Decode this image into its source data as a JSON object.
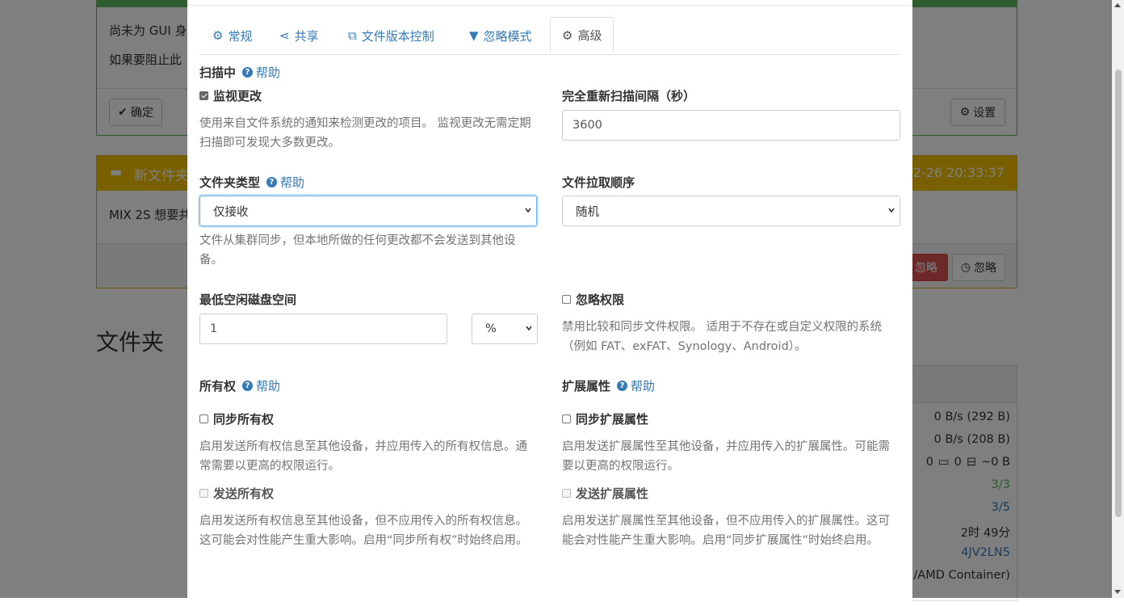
{
  "background": {
    "notice_text1": "尚未为 GUI 身",
    "notice_text2": "如果要阻止此",
    "ok_button": "确定",
    "settings_button": "设置",
    "folder_panel_title": "新文件夹",
    "folder_panel_time": "2-26 20:33:37",
    "folder_panel_text": "MIX 2S 想要共",
    "ignore_red_button": "忽略",
    "ignore_button": "忽略",
    "folders_heading": "文件夹",
    "stats": [
      "0 B/s (292 B)",
      "0 B/s (208 B)",
      "0",
      "0",
      "~0 B",
      "3/3",
      "3/5",
      "2时 49分",
      "4JV2LN5",
      "/AMD Container)"
    ]
  },
  "tabs": [
    {
      "label": "常规",
      "icon": "gear-icon"
    },
    {
      "label": "共享",
      "icon": "share-icon"
    },
    {
      "label": "文件版本控制",
      "icon": "copy-icon"
    },
    {
      "label": "忽略模式",
      "icon": "filter-icon"
    },
    {
      "label": "高级",
      "icon": "gears-icon",
      "active": true
    }
  ],
  "scanning": {
    "heading": "扫描中",
    "help": "帮助",
    "watch_label": "监视更改",
    "watch_checked": true,
    "watch_desc": "使用来自文件系统的通知来检测更改的项目。 监视更改无需定期扫描即可发现大多数更改。",
    "rescan_label": "完全重新扫描间隔（秒）",
    "rescan_value": "3600"
  },
  "folder_type": {
    "label": "文件夹类型",
    "help": "帮助",
    "value": "仅接收",
    "desc": "文件从集群同步，但本地所做的任何更改都不会发送到其他设备。"
  },
  "pull_order": {
    "label": "文件拉取顺序",
    "value": "随机"
  },
  "min_disk": {
    "label": "最低空闲磁盘空间",
    "value": "1",
    "unit": "%"
  },
  "ignore_perms": {
    "label": "忽略权限",
    "checked": false,
    "desc": "禁用比较和同步文件权限。 适用于不存在或自定义权限的系统（例如 FAT、exFAT、Synology、Android）。"
  },
  "ownership": {
    "heading": "所有权",
    "help": "帮助",
    "sync_label": "同步所有权",
    "sync_desc": "启用发送所有权信息至其他设备，并应用传入的所有权信息。通常需要以更高的权限运行。",
    "send_label": "发送所有权",
    "send_desc": "启用发送所有权信息至其他设备，但不应用传入的所有权信息。这可能会对性能产生重大影响。启用“同步所有权”时始终启用。"
  },
  "xattrs": {
    "heading": "扩展属性",
    "help": "帮助",
    "sync_label": "同步扩展属性",
    "sync_desc": "启用发送扩展属性至其他设备，并应用传入的扩展属性。可能需要以更高的权限运行。",
    "send_label": "发送扩展属性",
    "send_desc": "启用发送扩展属性至其他设备，但不应用传入的扩展属性。这可能会对性能产生重大影响。启用“同步扩展属性”时始终启用。"
  },
  "colors": {
    "link": "#337ab7",
    "success": "#5cb85c",
    "warning": "#f0ad4e",
    "danger": "#d9534f"
  }
}
